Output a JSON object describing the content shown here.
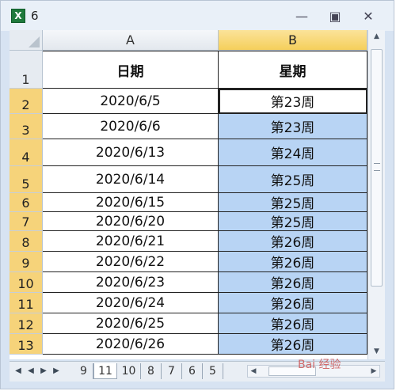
{
  "window": {
    "title": "6"
  },
  "columns": [
    "A",
    "B"
  ],
  "header_row": {
    "row_number": "1",
    "a": "日期",
    "b": "星期"
  },
  "rows": [
    {
      "row_number": "2",
      "a": "2020/6/5",
      "b": "第23周"
    },
    {
      "row_number": "3",
      "a": "2020/6/6",
      "b": "第23周"
    },
    {
      "row_number": "4",
      "a": "2020/6/13",
      "b": "第24周"
    },
    {
      "row_number": "5",
      "a": "2020/6/14",
      "b": "第25周"
    },
    {
      "row_number": "6",
      "a": "2020/6/15",
      "b": "第25周"
    },
    {
      "row_number": "7",
      "a": "2020/6/20",
      "b": "第25周"
    },
    {
      "row_number": "8",
      "a": "2020/6/21",
      "b": "第26周"
    },
    {
      "row_number": "9",
      "a": "2020/6/22",
      "b": "第26周"
    },
    {
      "row_number": "10",
      "a": "2020/6/23",
      "b": "第26周"
    },
    {
      "row_number": "11",
      "a": "2020/6/24",
      "b": "第26周"
    },
    {
      "row_number": "12",
      "a": "2020/6/25",
      "b": "第26周"
    },
    {
      "row_number": "13",
      "a": "2020/6/26",
      "b": "第26周"
    }
  ],
  "sheet_tabs": [
    "9",
    "11",
    "10",
    "8",
    "7",
    "6",
    "5"
  ],
  "active_sheet": "6",
  "colors": {
    "selection": "#b8d4f4",
    "header_selected": "#f5cf5b"
  },
  "watermark": "Bai 经验"
}
